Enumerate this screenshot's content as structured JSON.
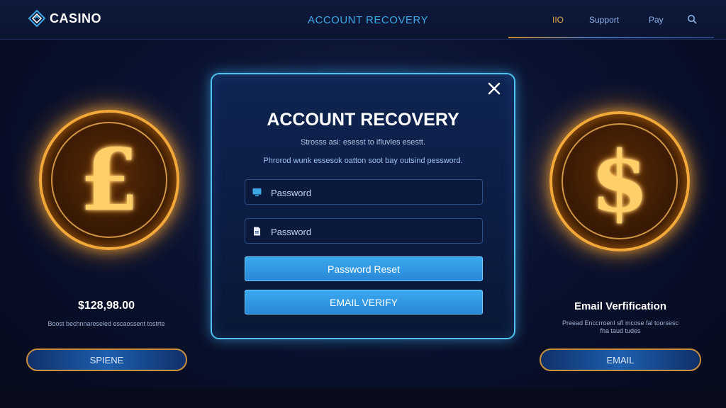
{
  "header": {
    "brand": "CASINO",
    "title": "ACCOUNT RECOVERY",
    "links": [
      "IIO",
      "Support",
      "Pay"
    ],
    "icons": {
      "logo": "diamond-logo-icon",
      "search": "search-icon"
    }
  },
  "modal": {
    "title": "ACCOUNT RECOVERY",
    "subtitle": "Strosss asi: esesst to ifluvles esestt.",
    "description": "Phrorod wunk essesok oatton soot bay outsind pessword.",
    "fields": [
      {
        "placeholder": "Password",
        "icon": "monitor-icon"
      },
      {
        "placeholder": "Password",
        "icon": "document-icon"
      }
    ],
    "buttons": {
      "reset": "Password Reset",
      "verify": "EMAIL VERIFY"
    },
    "close_icon": "close-icon"
  },
  "left_panel": {
    "coin_symbol": "£",
    "amount": "$128,98.00",
    "caption": "Boost bechnnareseled escaossent tostrte",
    "button": "SPIENE"
  },
  "right_panel": {
    "coin_symbol": "$",
    "title": "Email Verfification",
    "caption_line1": "Preead Enccrroenl sfI mcose fal toorsesc",
    "caption_line2": "fha taud tudes",
    "button": "EMAIL"
  },
  "colors": {
    "accent_blue": "#3aa9ee",
    "gold": "#f2a93a",
    "background": "#0a1230"
  }
}
